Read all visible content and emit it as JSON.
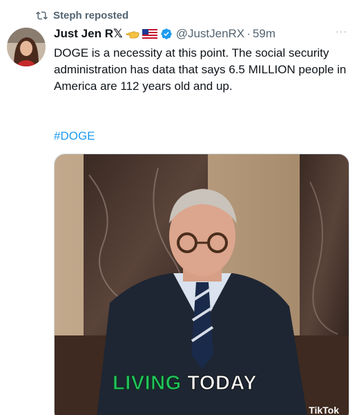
{
  "repost": {
    "text": "Steph reposted",
    "icon": "repost-icon"
  },
  "author": {
    "name": "Just Jen R",
    "name_suffix": "𝕏",
    "handle": "@JustJenRX",
    "separator": "·",
    "time": "59m",
    "more": "···"
  },
  "tweet": {
    "text": "DOGE is a necessity at this point. The social security administration has data that says 6.5 MILLION people in America are 112 years old and up.",
    "hashtag": "#DOGE"
  },
  "video": {
    "caption_green": "LIVING",
    "caption_white": "TODAY",
    "watermark": "TikTok"
  },
  "colors": {
    "link": "#1d9bf0",
    "verified": "#1d9bf0",
    "secondary_text": "#536471",
    "caption_green": "#22c55e"
  }
}
